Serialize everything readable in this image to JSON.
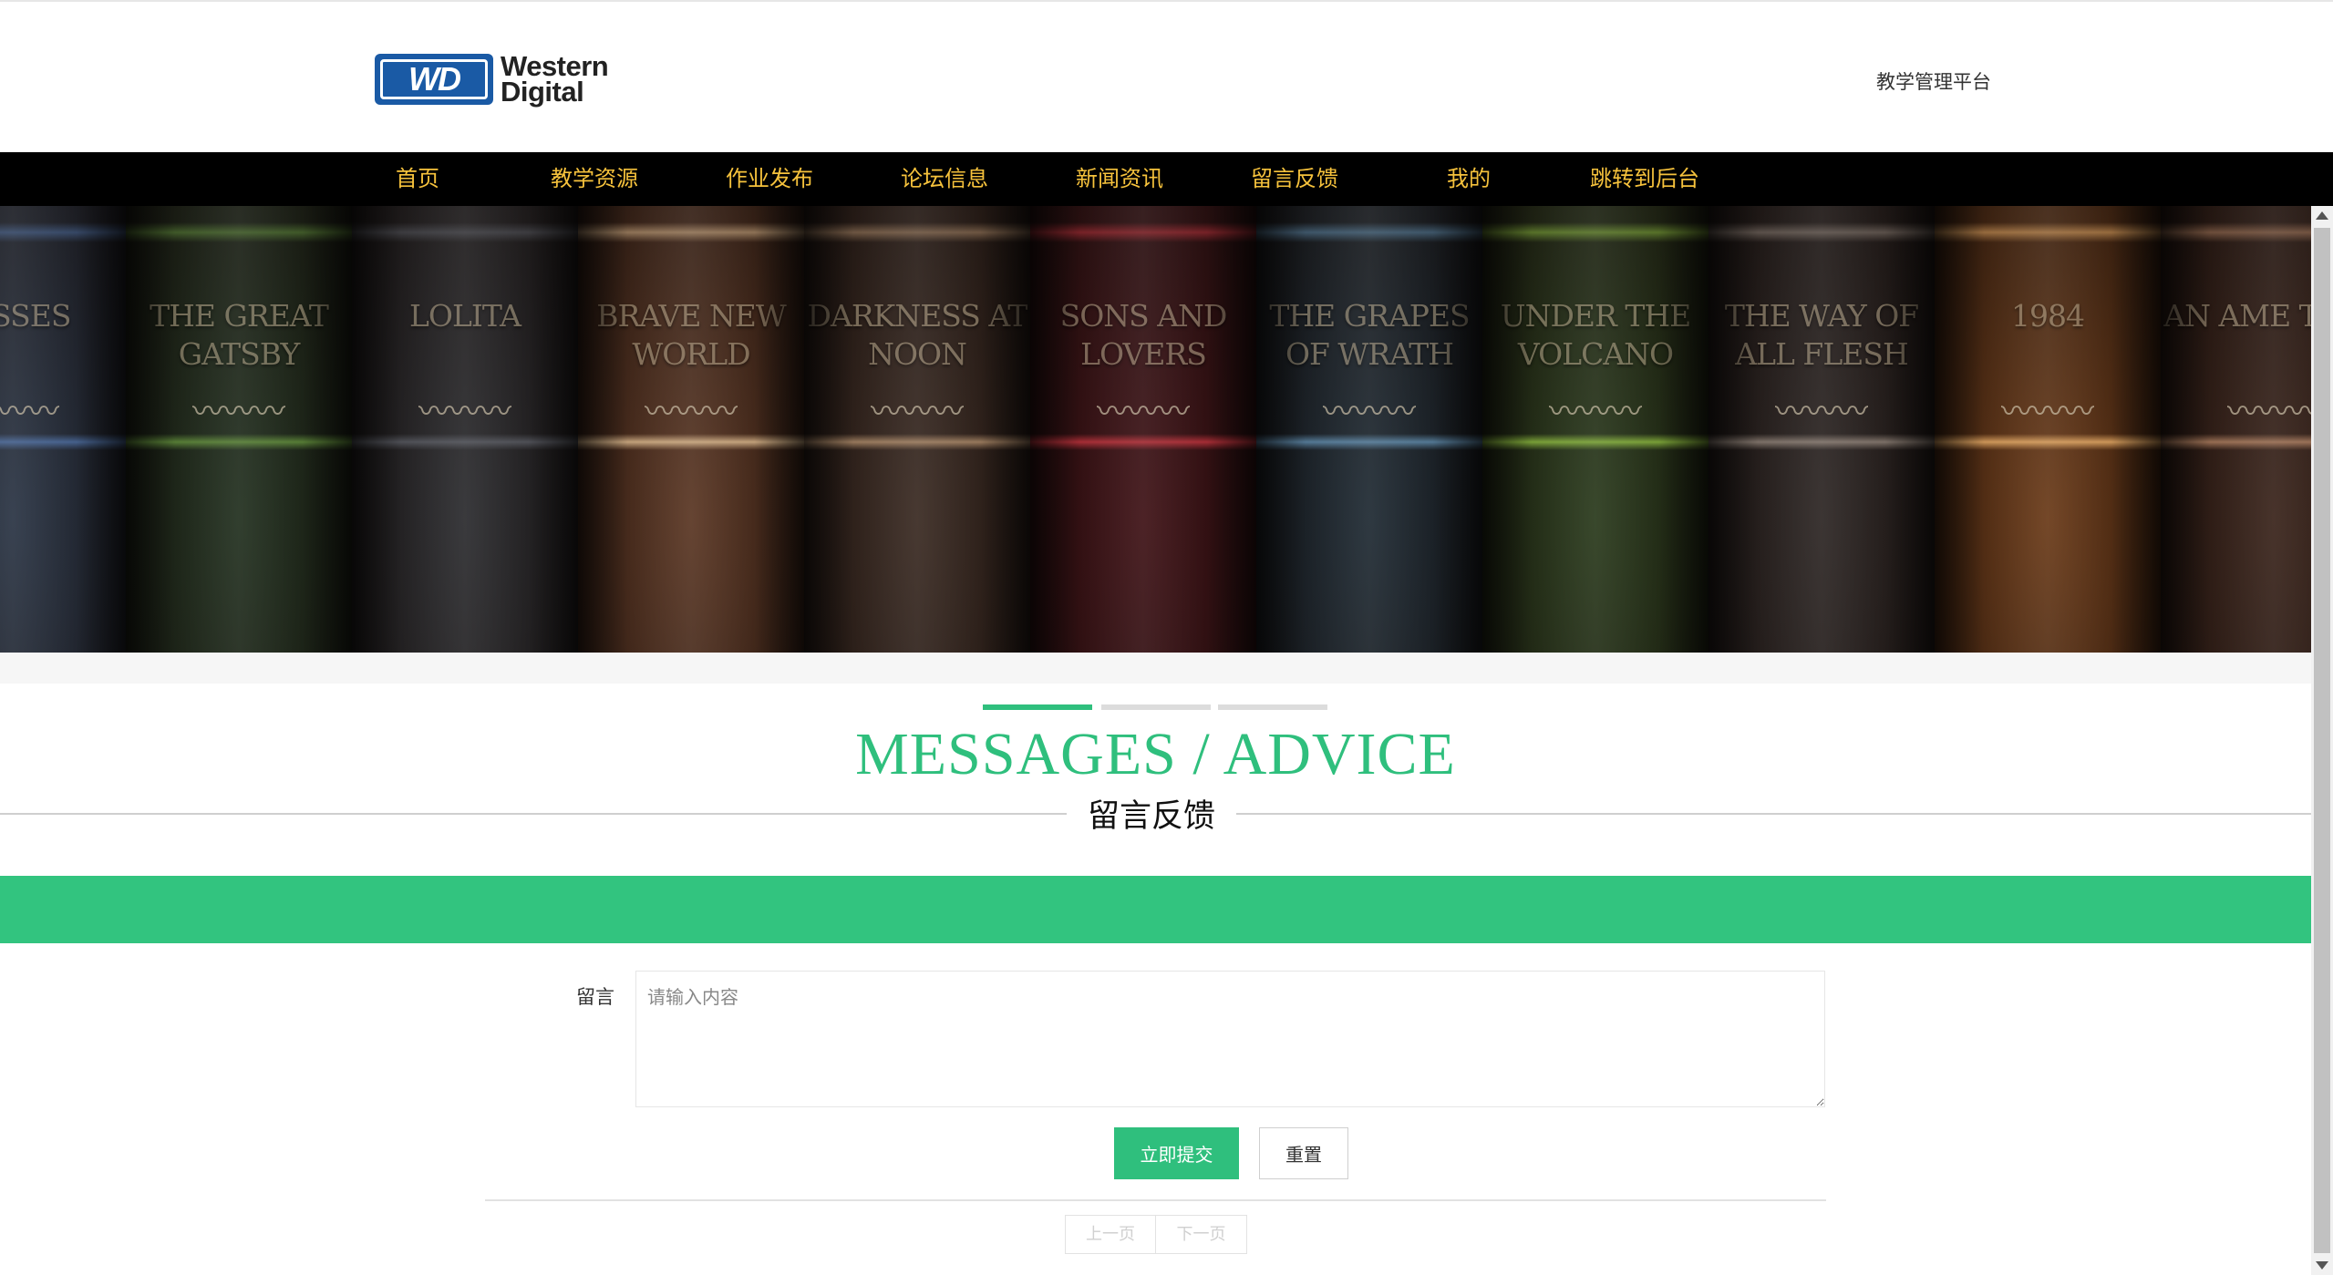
{
  "header": {
    "logo": {
      "badge": "WD",
      "line1": "Western",
      "line2": "Digital"
    },
    "platform_title": "教学管理平台"
  },
  "nav": {
    "items": [
      {
        "label": "首页"
      },
      {
        "label": "教学资源"
      },
      {
        "label": "作业发布"
      },
      {
        "label": "论坛信息"
      },
      {
        "label": "新闻资讯"
      },
      {
        "label": "留言反馈"
      },
      {
        "label": "我的"
      },
      {
        "label": "跳转到后台"
      }
    ],
    "text_color": "#f6c23c",
    "background": "#000000"
  },
  "banner": {
    "books": [
      {
        "title": "LYSSES",
        "color": "#2a3444",
        "band": "#4b6a9b"
      },
      {
        "title": "THE GREAT GATSBY",
        "color": "#22301f",
        "band": "#5f8a3a"
      },
      {
        "title": "LOLITA",
        "color": "#2b2b2e",
        "band": "#55575e"
      },
      {
        "title": "BRAVE NEW WORLD",
        "color": "#5a3623",
        "band": "#d7b58a"
      },
      {
        "title": "DARKNESS AT NOON",
        "color": "#3a2a22",
        "band": "#a88666"
      },
      {
        "title": "SONS AND LOVERS",
        "color": "#3f1216",
        "band": "#b8313a"
      },
      {
        "title": "THE GRAPES OF WRATH",
        "color": "#1f2a33",
        "band": "#5c86a6"
      },
      {
        "title": "UNDER THE VOLCANO",
        "color": "#2a3a1c",
        "band": "#86b23c"
      },
      {
        "title": "THE WAY OF ALL FLESH",
        "color": "#2d2624",
        "band": "#8a7d73"
      },
      {
        "title": "1984",
        "color": "#6a3a18",
        "band": "#e1a763"
      },
      {
        "title": "AN AME TRAG",
        "color": "#3a241b",
        "band": "#a87a5c"
      }
    ],
    "flourish": "〰〰〰"
  },
  "section": {
    "title": "MESSAGES / ADVICE",
    "subtitle": "留言反馈",
    "accent_color": "#2fbf7d"
  },
  "form": {
    "label": "留言",
    "textarea_placeholder": "请输入内容",
    "submit_label": "立即提交",
    "reset_label": "重置"
  },
  "pagination": {
    "prev_label": "上一页",
    "next_label": "下一页"
  }
}
